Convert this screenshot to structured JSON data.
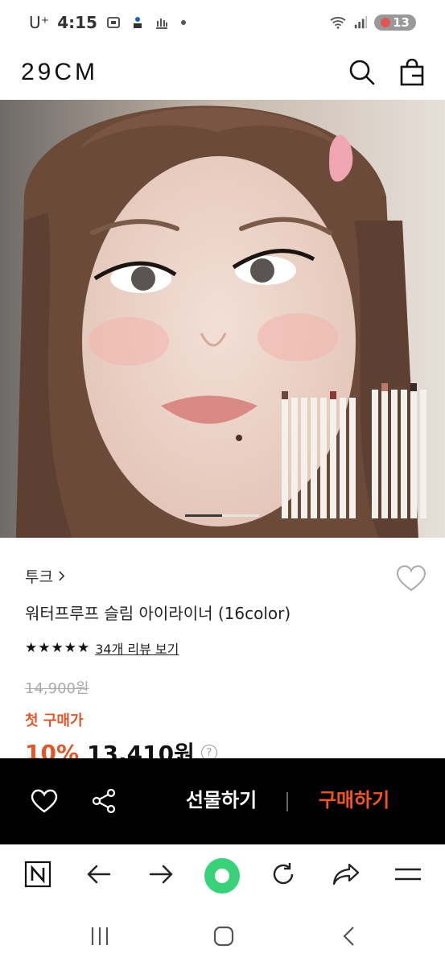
{
  "status_bar": {
    "carrier": "U⁺",
    "time": "4:15",
    "badge_count": "13"
  },
  "header": {
    "logo": "29CM",
    "search_icon": "search-icon",
    "cart_icon": "shopping-bag-icon"
  },
  "hero": {
    "slide_index": 1,
    "slide_total": 2
  },
  "product": {
    "brand": "투크",
    "name": "워터프루프 슬림 아이라이너 (16color)",
    "rating": 5,
    "review_link": "34개 리뷰 보기",
    "original_price": "14,900원",
    "first_purchase_label": "첫 구매가",
    "discount": "10%",
    "price": "13,410원",
    "help_icon": "?"
  },
  "action_bar": {
    "gift_label": "선물하기",
    "buy_label": "구매하기"
  },
  "colors": {
    "accent": "#e0582a",
    "action_bar_bg": "#000000",
    "browser_home": "#37d27a"
  }
}
